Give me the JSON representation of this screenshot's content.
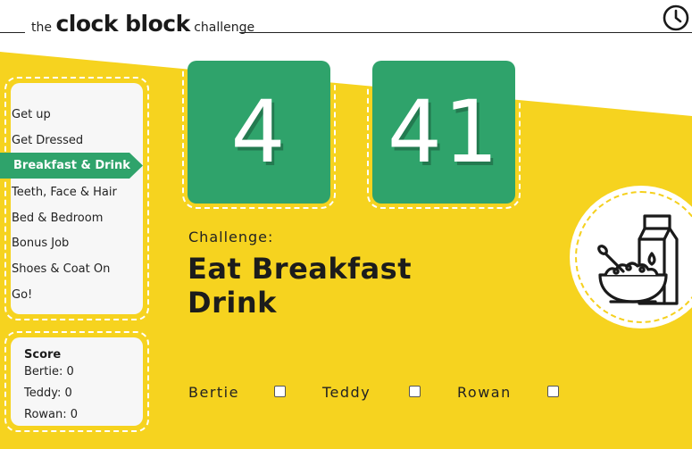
{
  "header": {
    "brand_prefix": "the",
    "brand_main": "clock block",
    "brand_suffix": "challenge",
    "clock_icon": "clock-icon"
  },
  "colors": {
    "yellow": "#f6d31f",
    "green": "#2fa36b",
    "panel": "#f7f7f7"
  },
  "steps": [
    {
      "label": "Get up"
    },
    {
      "label": "Get Dressed"
    },
    {
      "label": "Breakfast & Drink",
      "active": true
    },
    {
      "label": "Teeth, Face & Hair"
    },
    {
      "label": "Bed & Bedroom"
    },
    {
      "label": "Bonus Job"
    },
    {
      "label": "Shoes & Coat On"
    },
    {
      "label": "Go!"
    }
  ],
  "score": {
    "title": "Score",
    "entries": [
      {
        "text": "Bertie: 0"
      },
      {
        "text": "Teddy: 0"
      },
      {
        "text": "Rowan: 0"
      }
    ]
  },
  "timer": {
    "minutes": "4",
    "seconds": "41"
  },
  "challenge": {
    "label": "Challenge:",
    "text": "Eat Breakfast Drink"
  },
  "players": [
    {
      "name": "Bertie",
      "checked": false
    },
    {
      "name": "Teddy",
      "checked": false
    },
    {
      "name": "Rowan",
      "checked": false
    }
  ],
  "illustration_icon": "cereal-bowl-milk-icon"
}
